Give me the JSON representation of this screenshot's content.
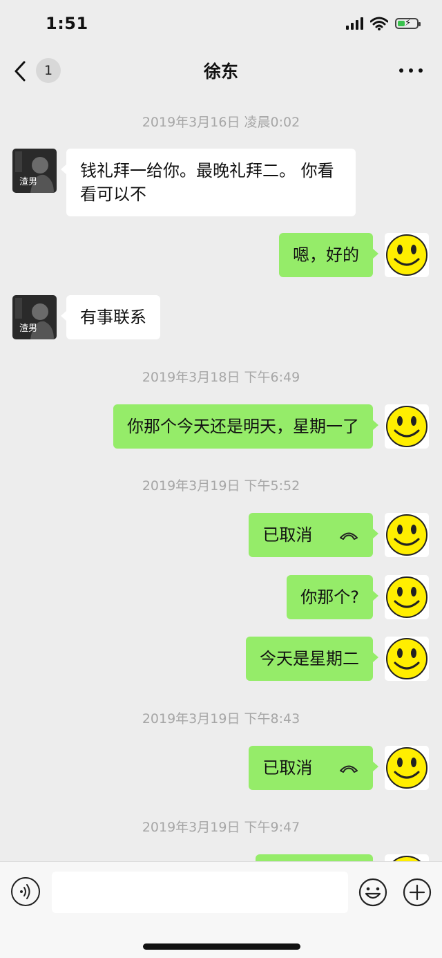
{
  "status_bar": {
    "time": "1:51"
  },
  "nav": {
    "back_badge": "1",
    "title": "徐东"
  },
  "contact_avatar_label": "渣男",
  "messages": [
    {
      "kind": "time",
      "text": "2019年3月16日 凌晨0:02"
    },
    {
      "kind": "in",
      "text": "钱礼拜一给你。最晚礼拜二。 你看看可以不"
    },
    {
      "kind": "out",
      "text": "嗯，好的"
    },
    {
      "kind": "in",
      "text": "有事联系"
    },
    {
      "kind": "time",
      "text": "2019年3月18日 下午6:49"
    },
    {
      "kind": "out",
      "text": "你那个今天还是明天，星期一了"
    },
    {
      "kind": "time",
      "text": "2019年3月19日 下午5:52"
    },
    {
      "kind": "out_call",
      "text": "已取消"
    },
    {
      "kind": "out",
      "text": "你那个?"
    },
    {
      "kind": "out",
      "text": "今天是星期二"
    },
    {
      "kind": "time",
      "text": "2019年3月19日 下午8:43"
    },
    {
      "kind": "out_call",
      "text": "已取消"
    },
    {
      "kind": "time",
      "text": "2019年3月19日 下午9:47"
    }
  ],
  "input": {
    "value": ""
  },
  "colors": {
    "background": "#ededed",
    "out_bubble": "#95ec69",
    "in_bubble": "#ffffff",
    "time_text": "#a6a6a6"
  },
  "icons": [
    "back-chevron-icon",
    "more-dots-icon",
    "voice-icon",
    "emoji-icon",
    "plus-icon",
    "phone-hangup-icon",
    "smiley-avatar-icon"
  ]
}
